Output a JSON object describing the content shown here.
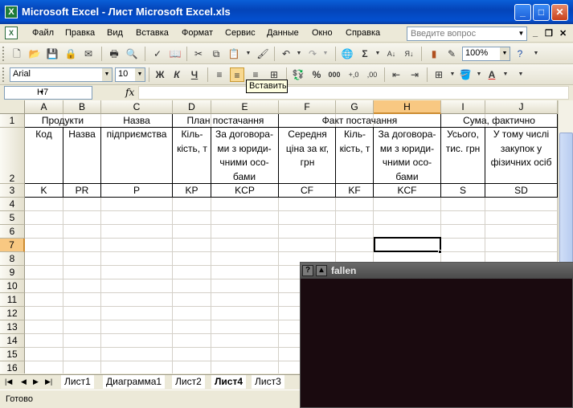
{
  "window": {
    "title": "Microsoft Excel - Лист Microsoft Excel.xls",
    "minimize": "_",
    "maximize": "□",
    "close": "✕"
  },
  "menu": {
    "items": [
      "Файл",
      "Правка",
      "Вид",
      "Вставка",
      "Формат",
      "Сервис",
      "Данные",
      "Окно",
      "Справка"
    ],
    "question_placeholder": "Введите вопрос",
    "mdi_minimize": "_",
    "mdi_restore": "❐",
    "mdi_close": "✕"
  },
  "toolbar": {
    "zoom": "100%"
  },
  "format_toolbar": {
    "font_name": "Arial",
    "font_size": "10",
    "bold": "Ж",
    "italic": "К",
    "underline": "Ч",
    "percent": "%",
    "thousands": "000",
    "inc_decimal": "+,0",
    "dec_decimal": ",00"
  },
  "tooltip": "Вставить",
  "formula_bar": {
    "name_box": "H7",
    "fx": "fx",
    "value": ""
  },
  "columns": [
    "A",
    "B",
    "C",
    "D",
    "E",
    "F",
    "G",
    "H",
    "I",
    "J"
  ],
  "rows": [
    "1",
    "2",
    "3",
    "4",
    "5",
    "6",
    "7",
    "8",
    "9",
    "10",
    "11",
    "12",
    "13",
    "14",
    "15",
    "16"
  ],
  "cells": {
    "r1": {
      "products": "Продукти",
      "enterprise_name": "Назва",
      "plan": "План постачання",
      "fact": "Факт постачання",
      "sum": "Сума, фактично"
    },
    "r2": {
      "a": "Код",
      "b": "Назва",
      "c": "підприємства",
      "d": "Кіль-кість, т",
      "e": "За договора-ми з юриди-чними осо-бами",
      "f": "Середня ціна за кг, грн",
      "g": "Кіль-кість, т",
      "h": "За договора-ми з юриди-чними осо-бами",
      "i": "Усього, тис. грн",
      "j": "У тому числі закупок у фізичних осіб"
    },
    "r3": {
      "a": "K",
      "b": "PR",
      "c": "P",
      "d": "KP",
      "e": "KCP",
      "f": "CF",
      "g": "KF",
      "h": "KCF",
      "i": "S",
      "j": "SD"
    }
  },
  "sheets": [
    "Лист1",
    "Диаграмма1",
    "Лист2",
    "Лист4",
    "Лист3"
  ],
  "active_sheet": "Лист4",
  "status": "Готово",
  "terminal": {
    "title": "fallen",
    "help_btn": "?",
    "up_btn": "▲"
  }
}
